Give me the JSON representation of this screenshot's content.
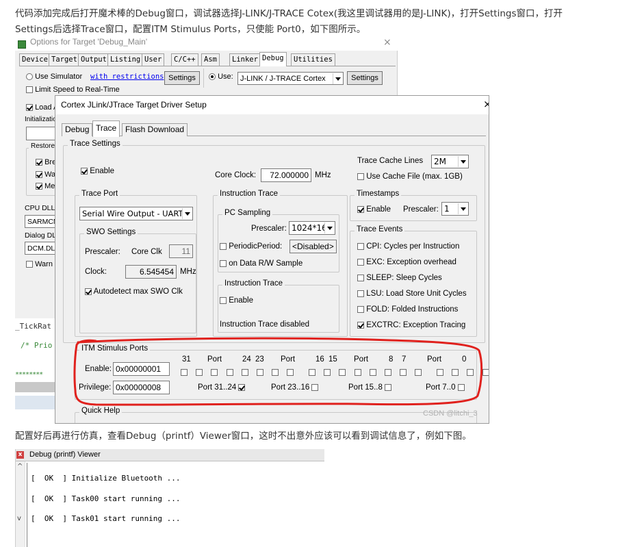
{
  "para1": {
    "line1": "代码添加完成后打开魔术棒的Debug窗口，调试器选择J-LINK/J-TRACE Cotex(我这里调试器用的是J-LINK)，打开Settings窗口，打开",
    "line2": "Settings后选择Trace窗口，配置ITM Stimulus Ports，只使能 Port0，如下图所示。"
  },
  "options": {
    "title": "Options for Target 'Debug_Main'",
    "tabs": [
      "Device",
      "Target",
      "Output",
      "Listing",
      "User",
      "C/C++",
      "Asm",
      "Linker",
      "Debug",
      "Utilities"
    ],
    "active_tab": "Debug",
    "use_simulator": "Use Simulator",
    "with_restrictions": "with restrictions",
    "settings": "Settings",
    "limit_speed": "Limit Speed to Real-Time",
    "use": "Use:",
    "debugger": "J-LINK / J-TRACE Cortex",
    "load": "Load A",
    "initialization": "Initializatio",
    "restore": "Restore",
    "restore_items": [
      "Bre",
      "Wa",
      "Me"
    ],
    "cpu_dll": "CPU DLL:",
    "cpu_dll_value": "SARMCM",
    "dialog_dll": "Dialog DL",
    "dialog_dll_value": "DCM.DLL",
    "warn": "Warn"
  },
  "code": {
    "tick": "_TickRat",
    "prio": "/* Prio",
    "stars": "********"
  },
  "jlink": {
    "title": "Cortex JLink/JTrace Target Driver Setup",
    "tabs": [
      "Debug",
      "Trace",
      "Flash Download"
    ],
    "active_tab": "Trace",
    "trace_settings": "Trace Settings",
    "enable": "Enable",
    "core_clock_label": "Core Clock:",
    "core_clock_value": "72.000000",
    "mhz": "MHz",
    "cache_lines_label": "Trace Cache Lines",
    "cache_lines_value": "2M",
    "use_cache_file": "Use Cache File (max. 1GB)",
    "trace_port": "Trace Port",
    "trace_port_value": "Serial Wire Output - UART/N",
    "swo_settings": "SWO Settings",
    "prescaler": "Prescaler:",
    "core_clk": "Core Clk",
    "swo_prescaler_value": "11",
    "clock": "Clock:",
    "clock_value": "6.545454",
    "autodetect": "Autodetect max SWO Clk",
    "instruction_trace": "Instruction Trace",
    "pc_sampling": "PC Sampling",
    "pc_prescaler_value": "1024*16",
    "periodic": "PeriodicPeriod:",
    "periodic_value": "<Disabled>",
    "on_data": "on Data R/W Sample",
    "itrace_inner": "Instruction Trace",
    "itrace_enable": "Enable",
    "itrace_disabled": "Instruction Trace disabled",
    "timestamps": "Timestamps",
    "ts_enable": "Enable",
    "ts_prescaler": "Prescaler:",
    "ts_prescaler_value": "1",
    "trace_events": "Trace Events",
    "events": [
      {
        "label": "CPI: Cycles per Instruction",
        "checked": false
      },
      {
        "label": "EXC: Exception overhead",
        "checked": false
      },
      {
        "label": "SLEEP: Sleep Cycles",
        "checked": false
      },
      {
        "label": "LSU: Load Store Unit Cycles",
        "checked": false
      },
      {
        "label": "FOLD: Folded Instructions",
        "checked": false
      },
      {
        "label": "EXCTRC: Exception Tracing",
        "checked": true
      }
    ],
    "itm_title": "ITM Stimulus Ports",
    "itm_enable": "Enable:",
    "itm_enable_value": "0x00000001",
    "itm_privilege": "Privilege:",
    "itm_privilege_value": "0x00000008",
    "port_header": [
      "31",
      "Port",
      "24",
      "23",
      "Port",
      "16",
      "15",
      "Port",
      "8",
      "7",
      "Port",
      "0"
    ],
    "privs": [
      {
        "label": "Port 31..24",
        "checked": true
      },
      {
        "label": "Port 23..16",
        "checked": false
      },
      {
        "label": "Port 15..8",
        "checked": false
      },
      {
        "label": "Port 7..0",
        "checked": false
      }
    ],
    "quick_help": "Quick Help",
    "watermark": "CSDN @litchi_3",
    "highlight_color": "#e0211d"
  },
  "para2": "配置好后再进行仿真，查看Debug（printf）Viewer窗口，这时不出意外应该可以看到调试信息了，例如下图。",
  "viewer": {
    "title": "Debug (printf) Viewer",
    "lines": [
      "[  OK  ] Initialize Bluetooth ...",
      "[  OK  ] Task00 start running ...",
      "[  OK  ] Task01 start running ..."
    ]
  }
}
